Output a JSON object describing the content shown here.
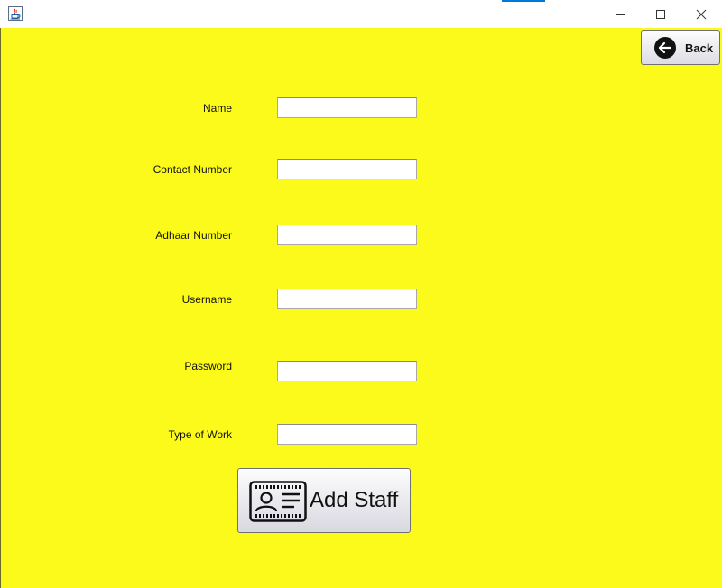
{
  "window": {
    "title": "",
    "controls": {
      "minimize": "minimize-icon",
      "maximize": "maximize-icon",
      "close": "close-icon"
    }
  },
  "colors": {
    "background": "#fcfa1a",
    "titlebar": "#ffffff",
    "accent": "#0078d7"
  },
  "back_button": {
    "label": "Back",
    "icon": "arrow-left-circle-icon"
  },
  "form": {
    "fields": [
      {
        "label": "Name",
        "value": "",
        "placeholder": ""
      },
      {
        "label": "Contact Number",
        "value": "",
        "placeholder": ""
      },
      {
        "label": "Adhaar Number",
        "value": "",
        "placeholder": ""
      },
      {
        "label": "Username",
        "value": "",
        "placeholder": ""
      },
      {
        "label": "Password",
        "value": "",
        "placeholder": ""
      },
      {
        "label": "Type of Work",
        "value": "",
        "placeholder": ""
      }
    ],
    "submit": {
      "label": "Add Staff",
      "icon": "id-card-icon"
    }
  }
}
